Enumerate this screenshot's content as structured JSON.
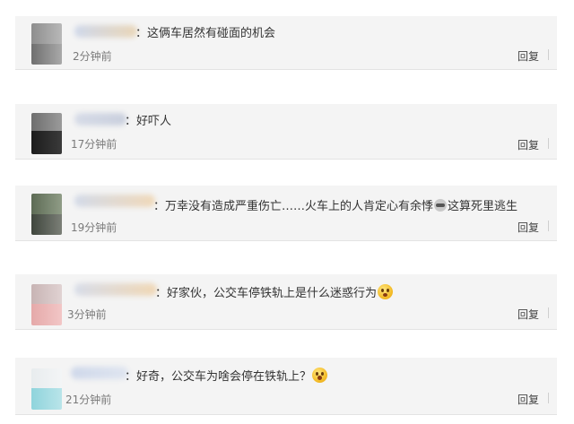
{
  "comments": [
    {
      "text": "：这俩车居然有碰面的机会",
      "time": "2分钟前",
      "reply": "回复"
    },
    {
      "text": "：好吓人",
      "time": "17分钟前",
      "reply": "回复"
    },
    {
      "text_before": "：万幸没有造成严重伤亡……火车上的人肯定心有余悸",
      "icon": "grimace-emoji-icon",
      "text_after": "这算死里逃生",
      "time": "19分钟前",
      "reply": "回复"
    },
    {
      "text": "：好家伙，公交车停铁轨上是什么迷惑行为",
      "icon": "thinking-emoji-icon",
      "time": "3分钟前",
      "reply": "回复"
    },
    {
      "text": "：好奇，公交车为啥会停在铁轨上？",
      "icon": "surprised-emoji-icon",
      "time": "21分钟前",
      "reply": "回复"
    }
  ],
  "colors": {
    "card_bg": "#f4f4f4",
    "text": "#333333",
    "time_text": "#7a7a7a",
    "reply_text": "#444444"
  }
}
